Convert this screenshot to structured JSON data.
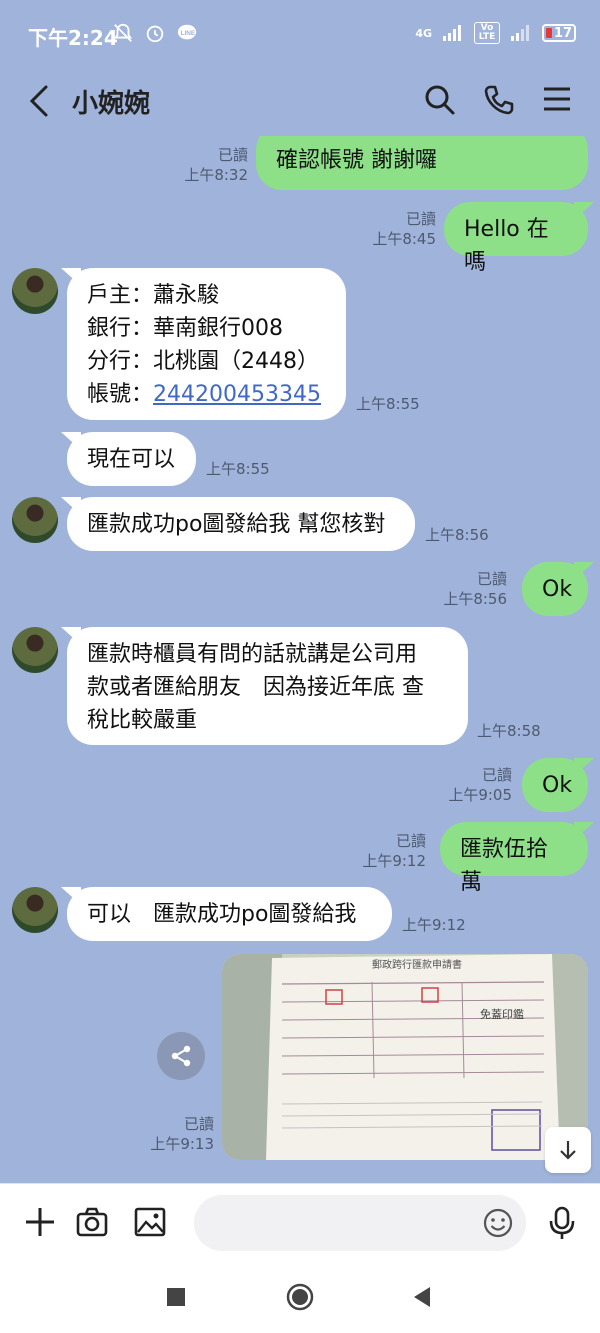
{
  "status": {
    "time": "下午2:24",
    "network_4g": "4G",
    "volte": "Vo LTE",
    "battery": "17",
    "battery_color": "#e53935"
  },
  "header": {
    "title": "小婉婉",
    "back_icon": "back-arrow-icon"
  },
  "colors": {
    "background": "#9fb3db",
    "sent_bubble": "#8de087",
    "received_bubble": "#ffffff",
    "link": "#3f68c7"
  },
  "messages": [
    {
      "side": "sent",
      "text": "確認帳號 謝謝囉",
      "read": "已讀",
      "time": "上午8:32"
    },
    {
      "side": "sent",
      "text": "Hello 在嗎",
      "read": "已讀",
      "time": "上午8:45"
    },
    {
      "side": "received",
      "lines": [
        "戶主：蕭永駿",
        "銀行：華南銀行008",
        "分行：北桃園（2448）"
      ],
      "account_label": "帳號：",
      "account_number": "244200453345",
      "time": "上午8:55"
    },
    {
      "side": "received",
      "text": "現在可以",
      "time": "上午8:55"
    },
    {
      "side": "received",
      "text": "匯款成功po圖發給我 幫您核對",
      "time": "上午8:56"
    },
    {
      "side": "sent",
      "text": "Ok",
      "read": "已讀",
      "time": "上午8:56"
    },
    {
      "side": "received",
      "lines": [
        "匯款時櫃員有問的話就講是公司用",
        "款或者匯給朋友　因為接近年底 查",
        "稅比較嚴重"
      ],
      "time": "上午8:58"
    },
    {
      "side": "sent",
      "text": "Ok",
      "read": "已讀",
      "time": "上午9:05"
    },
    {
      "side": "sent",
      "text": "匯款伍拾萬",
      "read": "已讀",
      "time": "上午9:12"
    },
    {
      "side": "received",
      "text": "可以　匯款成功po圖發給我",
      "time": "上午9:12"
    },
    {
      "side": "sent",
      "type": "image",
      "image_title": "郵政跨行匯款申請書",
      "stamp": "免蓋印鑑",
      "read": "已讀",
      "time": "上午9:13"
    }
  ],
  "input": {
    "plus_icon": "plus-icon",
    "camera_icon": "camera-icon",
    "image_icon": "image-icon",
    "emoji_icon": "emoji-icon",
    "mic_icon": "microphone-icon"
  }
}
